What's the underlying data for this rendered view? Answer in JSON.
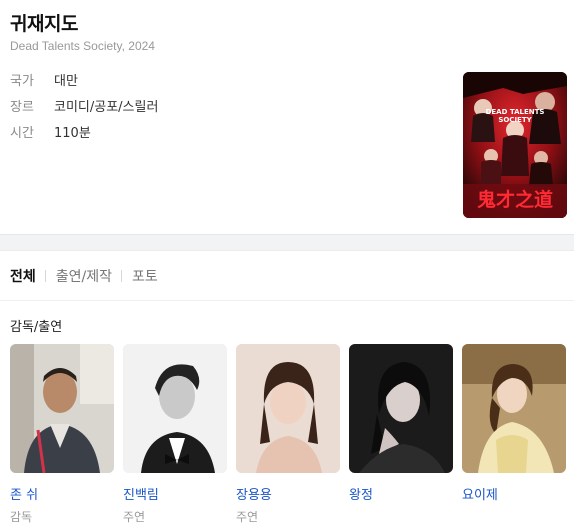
{
  "movie": {
    "title": "귀재지도",
    "subtitle": "Dead Talents Society, 2024",
    "info": [
      {
        "key": "국가",
        "value": "대만"
      },
      {
        "key": "장르",
        "value": "코미디/공포/스릴러"
      },
      {
        "key": "시간",
        "value": "110분"
      }
    ],
    "poster": {
      "title_text": "鬼才之道",
      "english_text": "DEAD TALENTS SOCIETY"
    }
  },
  "tabs": [
    "전체",
    "출연/제작",
    "포토"
  ],
  "cast_section": {
    "title": "감독/출연",
    "people": [
      {
        "name": "존 쉬",
        "role": "감독"
      },
      {
        "name": "진백림",
        "role": "주연"
      },
      {
        "name": "장용용",
        "role": "주연"
      },
      {
        "name": "왕정",
        "role": ""
      },
      {
        "name": "요이제",
        "role": ""
      }
    ]
  },
  "colors": {
    "link": "#1a56c9",
    "poster_red": "#c0161f"
  }
}
